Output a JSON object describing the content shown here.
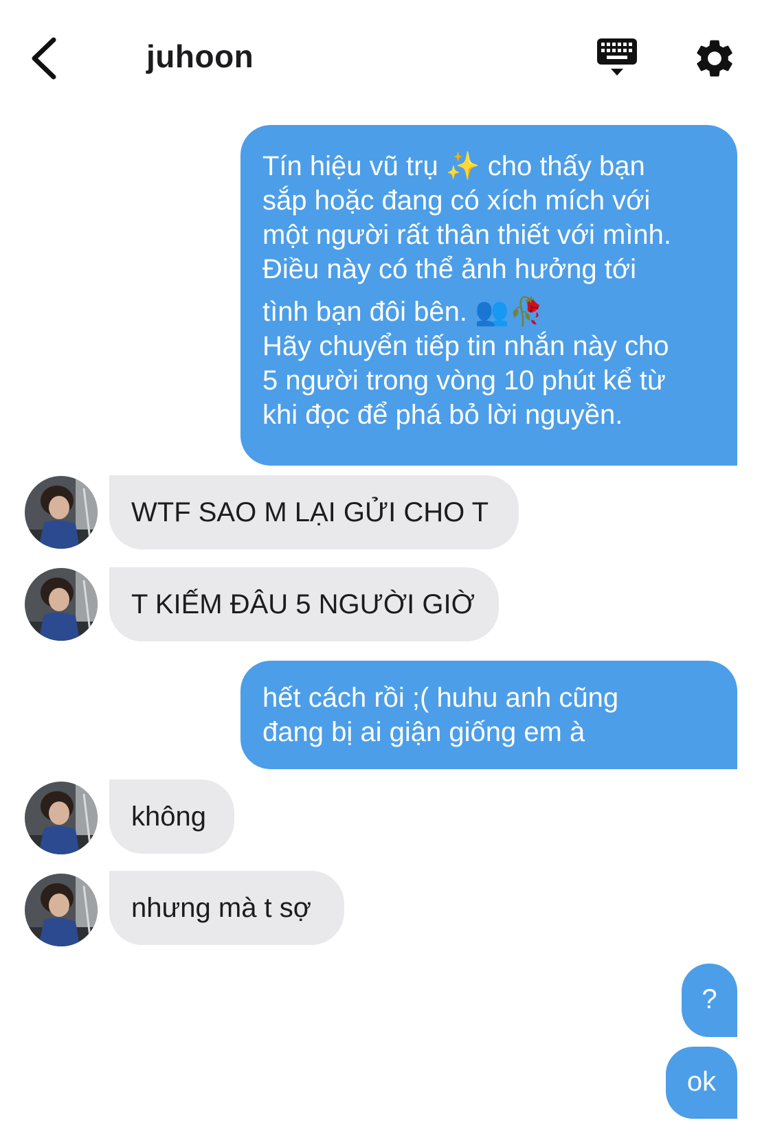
{
  "header": {
    "title": "juhoon",
    "back_icon": "chevron-left-icon",
    "keyboard_icon": "keyboard-icon",
    "settings_icon": "gear-icon"
  },
  "colors": {
    "outgoing_bubble": "#4c9ee8",
    "incoming_bubble": "#e9e9eb",
    "text_dark": "#1c1c1e"
  },
  "messages": [
    {
      "direction": "outgoing",
      "lines": [
        "Tín hiệu vũ trụ ✨ cho thấy bạn",
        "sắp hoặc đang có xích mích với",
        "một người rất thân thiết với mình.",
        "Điều này có thể ảnh hưởng tới",
        "tình bạn đôi bên. 👥🥀",
        "Hãy chuyển tiếp tin nhắn này cho",
        "5 người trong vòng 10 phút kể từ",
        "khi đọc để phá bỏ lời nguyền."
      ]
    },
    {
      "direction": "incoming",
      "text": "WTF SAO M LẠI GỬI CHO T"
    },
    {
      "direction": "incoming",
      "text": "T KIẾM ĐÂU 5 NGƯỜI GIỜ"
    },
    {
      "direction": "outgoing",
      "lines": [
        "hết cách rồi ;( huhu anh cũng",
        "đang bị ai giận giống em à"
      ]
    },
    {
      "direction": "incoming",
      "text": "không"
    },
    {
      "direction": "incoming",
      "text": "nhưng mà t sợ"
    },
    {
      "direction": "outgoing",
      "text": "?"
    },
    {
      "direction": "outgoing",
      "text": "ok"
    }
  ]
}
